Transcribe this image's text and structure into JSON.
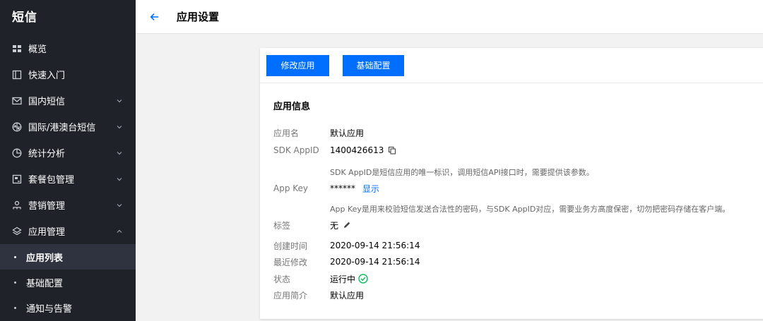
{
  "sidebar": {
    "brand": "短信",
    "items": [
      {
        "label": "概览",
        "icon": "grid-icon"
      },
      {
        "label": "快速入门",
        "icon": "book-icon"
      },
      {
        "label": "国内短信",
        "icon": "mail-icon"
      },
      {
        "label": "国际/港澳台短信",
        "icon": "globe-icon"
      },
      {
        "label": "统计分析",
        "icon": "pie-chart-icon"
      },
      {
        "label": "套餐包管理",
        "icon": "package-icon"
      },
      {
        "label": "营销管理",
        "icon": "users-icon"
      },
      {
        "label": "应用管理",
        "icon": "layers-icon"
      }
    ],
    "sub_items": [
      {
        "label": "应用列表",
        "active": true
      },
      {
        "label": "基础配置"
      },
      {
        "label": "通知与告警"
      }
    ]
  },
  "header": {
    "title": "应用设置"
  },
  "toolbar": {
    "edit_app_label": "修改应用",
    "basic_config_label": "基础配置"
  },
  "app_info": {
    "section_title": "应用信息",
    "name_label": "应用名",
    "name_value": "默认应用",
    "appid_label": "SDK AppID",
    "appid_value": "1400426613",
    "appid_hint": "SDK AppID是短信应用的唯一标识，调用短信API接口时，需要提供该参数。",
    "appkey_label": "App Key",
    "appkey_value": "******",
    "appkey_show": "显示",
    "appkey_hint": "App Key是用来校验短信发送合法性的密码，与SDK AppID对应，需要业务方高度保密，切勿把密码存储在客户端。",
    "tag_label": "标签",
    "tag_value": "无",
    "created_label": "创建时间",
    "created_value": "2020-09-14 21:56:14",
    "modified_label": "最近修改",
    "modified_value": "2020-09-14 21:56:14",
    "status_label": "状态",
    "status_value": "运行中",
    "desc_label": "应用简介",
    "desc_value": "默认应用"
  },
  "colors": {
    "accent": "#006eff",
    "sidebar_bg": "#1f2229",
    "status_ok": "#0abf5b"
  }
}
